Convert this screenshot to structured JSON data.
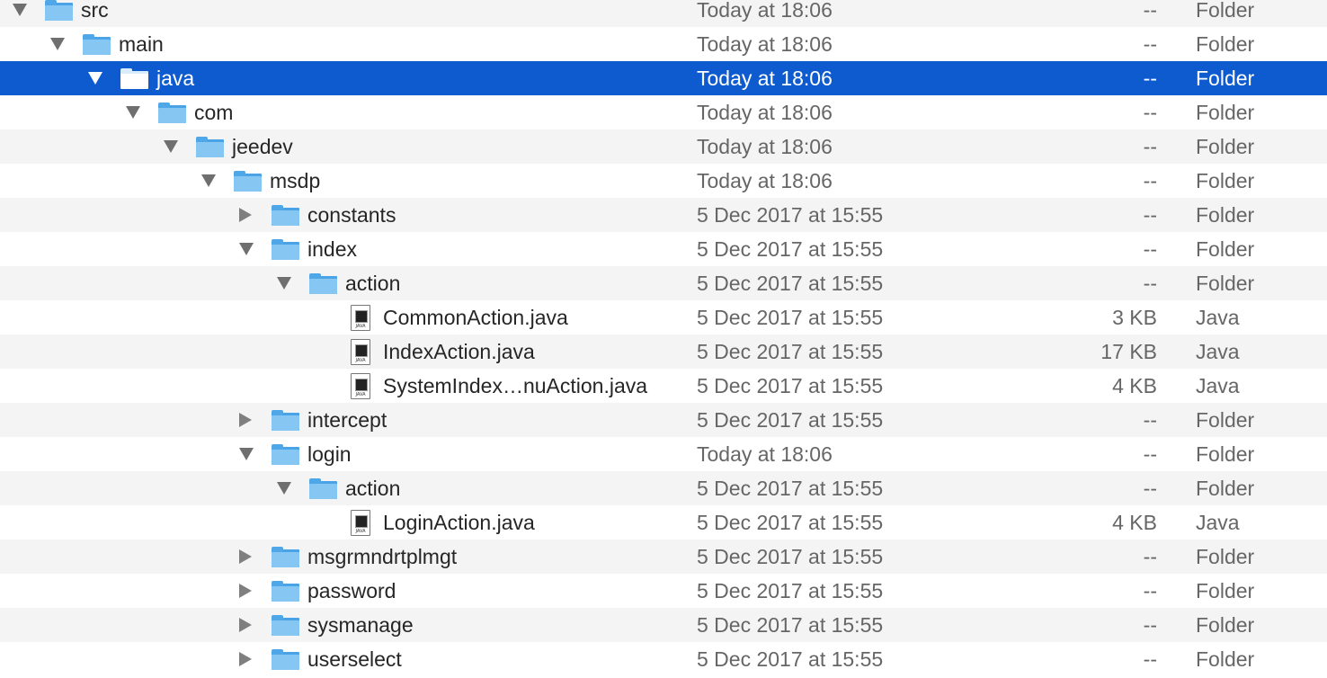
{
  "icons": {
    "folder": "folder-icon",
    "file": "java-file-icon",
    "disclosure": "disclosure-triangle-icon"
  },
  "colors": {
    "selection": "#0e5bd0",
    "stripe": "#f4f4f4",
    "folder": "#86c6f2"
  },
  "file_badge": "JAVA",
  "rows": [
    {
      "name": "src",
      "depth": 0,
      "state": "expanded",
      "type": "folder",
      "date": "Today at 18:06",
      "size": "--",
      "kind": "Folder"
    },
    {
      "name": "main",
      "depth": 1,
      "state": "expanded",
      "type": "folder",
      "date": "Today at 18:06",
      "size": "--",
      "kind": "Folder"
    },
    {
      "name": "java",
      "depth": 2,
      "state": "expanded",
      "type": "folder",
      "date": "Today at 18:06",
      "size": "--",
      "kind": "Folder",
      "selected": true
    },
    {
      "name": "com",
      "depth": 3,
      "state": "expanded",
      "type": "folder",
      "date": "Today at 18:06",
      "size": "--",
      "kind": "Folder"
    },
    {
      "name": "jeedev",
      "depth": 4,
      "state": "expanded",
      "type": "folder",
      "date": "Today at 18:06",
      "size": "--",
      "kind": "Folder"
    },
    {
      "name": "msdp",
      "depth": 5,
      "state": "expanded",
      "type": "folder",
      "date": "Today at 18:06",
      "size": "--",
      "kind": "Folder"
    },
    {
      "name": "constants",
      "depth": 6,
      "state": "collapsed",
      "type": "folder",
      "date": "5 Dec 2017 at 15:55",
      "size": "--",
      "kind": "Folder"
    },
    {
      "name": "index",
      "depth": 6,
      "state": "expanded",
      "type": "folder",
      "date": "5 Dec 2017 at 15:55",
      "size": "--",
      "kind": "Folder"
    },
    {
      "name": "action",
      "depth": 7,
      "state": "expanded",
      "type": "folder",
      "date": "5 Dec 2017 at 15:55",
      "size": "--",
      "kind": "Folder"
    },
    {
      "name": "CommonAction.java",
      "depth": 8,
      "state": "none",
      "type": "file",
      "date": "5 Dec 2017 at 15:55",
      "size": "3 KB",
      "kind": "Java"
    },
    {
      "name": "IndexAction.java",
      "depth": 8,
      "state": "none",
      "type": "file",
      "date": "5 Dec 2017 at 15:55",
      "size": "17 KB",
      "kind": "Java"
    },
    {
      "name": "SystemIndex…nuAction.java",
      "depth": 8,
      "state": "none",
      "type": "file",
      "date": "5 Dec 2017 at 15:55",
      "size": "4 KB",
      "kind": "Java"
    },
    {
      "name": "intercept",
      "depth": 6,
      "state": "collapsed",
      "type": "folder",
      "date": "5 Dec 2017 at 15:55",
      "size": "--",
      "kind": "Folder"
    },
    {
      "name": "login",
      "depth": 6,
      "state": "expanded",
      "type": "folder",
      "date": "Today at 18:06",
      "size": "--",
      "kind": "Folder"
    },
    {
      "name": "action",
      "depth": 7,
      "state": "expanded",
      "type": "folder",
      "date": "5 Dec 2017 at 15:55",
      "size": "--",
      "kind": "Folder"
    },
    {
      "name": "LoginAction.java",
      "depth": 8,
      "state": "none",
      "type": "file",
      "date": "5 Dec 2017 at 15:55",
      "size": "4 KB",
      "kind": "Java"
    },
    {
      "name": "msgrmndrtplmgt",
      "depth": 6,
      "state": "collapsed",
      "type": "folder",
      "date": "5 Dec 2017 at 15:55",
      "size": "--",
      "kind": "Folder"
    },
    {
      "name": "password",
      "depth": 6,
      "state": "collapsed",
      "type": "folder",
      "date": "5 Dec 2017 at 15:55",
      "size": "--",
      "kind": "Folder"
    },
    {
      "name": "sysmanage",
      "depth": 6,
      "state": "collapsed",
      "type": "folder",
      "date": "5 Dec 2017 at 15:55",
      "size": "--",
      "kind": "Folder"
    },
    {
      "name": "userselect",
      "depth": 6,
      "state": "collapsed",
      "type": "folder",
      "date": "5 Dec 2017 at 15:55",
      "size": "--",
      "kind": "Folder"
    }
  ]
}
